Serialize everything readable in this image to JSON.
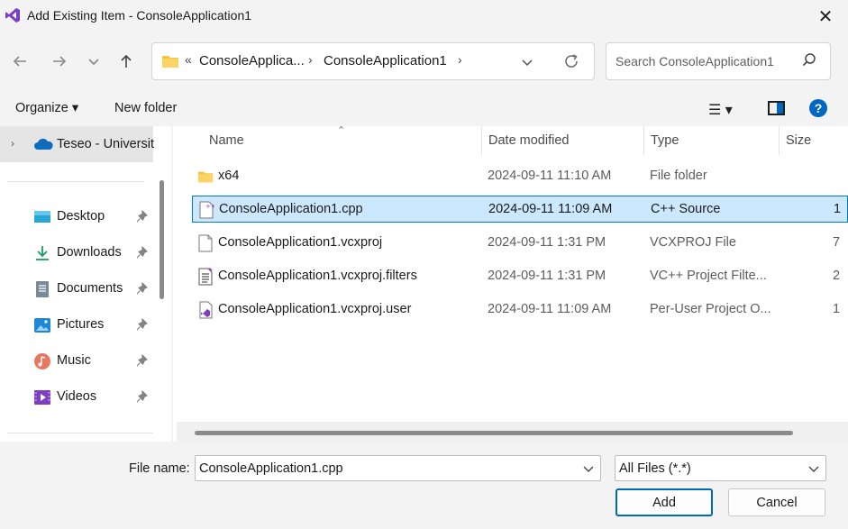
{
  "window": {
    "title": "Add Existing Item - ConsoleApplication1",
    "close_label": "✕"
  },
  "address": {
    "crumbs": [
      "«",
      "ConsoleApplica...",
      "›",
      "ConsoleApplication1",
      "›"
    ]
  },
  "search": {
    "placeholder": "Search ConsoleApplication1"
  },
  "toolbar": {
    "organize": "Organize ▾",
    "new_folder": "New folder",
    "view_menu": "☰ ▾",
    "help": "?"
  },
  "sidebar": {
    "cloud": "Teseo - Universit",
    "items": [
      {
        "label": "Desktop",
        "icon": "desktop-icon"
      },
      {
        "label": "Downloads",
        "icon": "downloads-icon"
      },
      {
        "label": "Documents",
        "icon": "documents-icon"
      },
      {
        "label": "Pictures",
        "icon": "pictures-icon"
      },
      {
        "label": "Music",
        "icon": "music-icon"
      },
      {
        "label": "Videos",
        "icon": "videos-icon"
      }
    ]
  },
  "columns": {
    "name": "Name",
    "date": "Date modified",
    "type": "Type",
    "size": "Size"
  },
  "files": [
    {
      "name": "x64",
      "date": "2024-09-11 11:10 AM",
      "type": "File folder",
      "size": "",
      "icon": "folder-icon"
    },
    {
      "name": "ConsoleApplication1.cpp",
      "date": "2024-09-11 11:09 AM",
      "type": "C++ Source",
      "size": "1",
      "icon": "cpp-file-icon",
      "selected": true
    },
    {
      "name": "ConsoleApplication1.vcxproj",
      "date": "2024-09-11 1:31 PM",
      "type": "VCXPROJ File",
      "size": "7",
      "icon": "blank-file-icon"
    },
    {
      "name": "ConsoleApplication1.vcxproj.filters",
      "date": "2024-09-11 1:31 PM",
      "type": "VC++ Project Filte...",
      "size": "2",
      "icon": "filters-file-icon"
    },
    {
      "name": "ConsoleApplication1.vcxproj.user",
      "date": "2024-09-11 11:09 AM",
      "type": "Per-User Project O...",
      "size": "1",
      "icon": "vs-user-file-icon"
    }
  ],
  "footer": {
    "file_name_label": "File name:",
    "file_name_value": "ConsoleApplication1.cpp",
    "filter_value": "All Files (*.*)",
    "add_label": "Add",
    "cancel_label": "Cancel"
  },
  "colors": {
    "accent": "#0067c0",
    "selection": "#cce8ff",
    "selection_border": "#0078d4",
    "folder": "#f8c440"
  }
}
